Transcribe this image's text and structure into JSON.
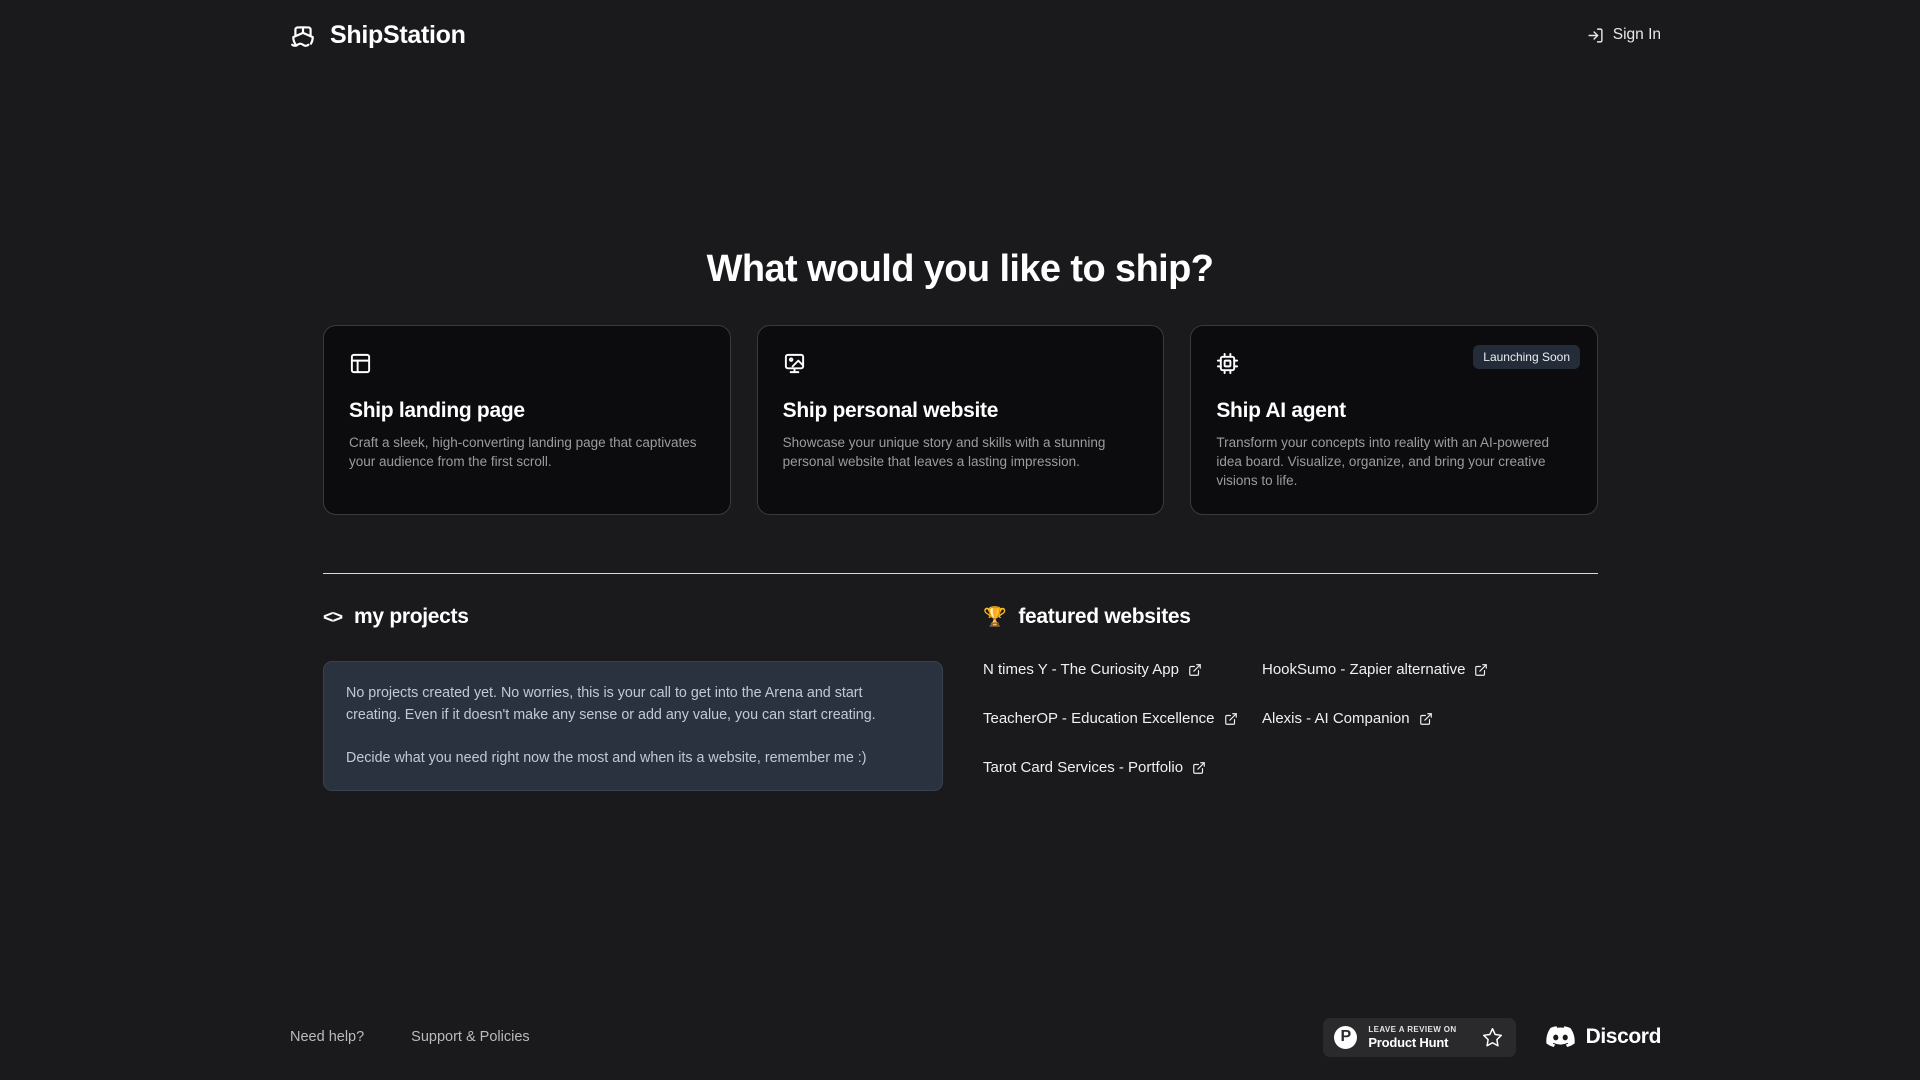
{
  "header": {
    "brand_name": "ShipStation",
    "brand_icon": "ship-icon",
    "signin_label": "Sign In",
    "signin_icon": "login-arrow-icon"
  },
  "hero": {
    "title": "What would you like to ship?"
  },
  "cards": [
    {
      "icon": "layout-panel-icon",
      "title": "Ship landing page",
      "description": "Craft a sleek, high-converting landing page that captivates your audience from the first scroll.",
      "badge": ""
    },
    {
      "icon": "image-icon",
      "title": "Ship personal website",
      "description": "Showcase your unique story and skills with a stunning personal website that leaves a lasting impression.",
      "badge": ""
    },
    {
      "icon": "cpu-chip-icon",
      "title": "Ship AI agent",
      "description": "Transform your concepts into reality with an AI-powered idea board. Visualize, organize, and bring your creative visions to life.",
      "badge": "Launching Soon"
    }
  ],
  "projects": {
    "icon": "code-brackets-icon",
    "icon_glyph": "<>",
    "heading": "my projects",
    "paragraph_1": "No projects created yet. No worries, this is your call to get into the Arena and start creating. Even if it doesn't make any sense or add any value, you can start creating.",
    "paragraph_2": "Decide what you need right now the most and when its a website, remember me :)"
  },
  "featured": {
    "icon": "trophy-icon",
    "icon_glyph": "🏆",
    "heading": "featured websites",
    "links": [
      {
        "label": "N times Y - The Curiosity App",
        "icon": "external-link-icon"
      },
      {
        "label": "HookSumo - Zapier alternative",
        "icon": "external-link-icon"
      },
      {
        "label": "TeacherOP - Education Excellence",
        "icon": "external-link-icon"
      },
      {
        "label": "Alexis - AI Companion",
        "icon": "external-link-icon"
      },
      {
        "label": "Tarot Card Services - Portfolio",
        "icon": "external-link-icon"
      }
    ]
  },
  "footer": {
    "links": [
      {
        "label": "Need help?"
      },
      {
        "label": "Support & Policies"
      }
    ],
    "product_hunt": {
      "logo_letter": "P",
      "top_text": "LEAVE A REVIEW ON",
      "bottom_text": "Product Hunt",
      "star_icon": "star-outline-icon"
    },
    "discord": {
      "icon": "discord-icon",
      "label": "Discord"
    }
  },
  "colors": {
    "page_background": "#1a1a1c",
    "card_background": "#0c0c0e",
    "card_border": "#3a3a3e",
    "projects_box": "#2a3240",
    "badge_background": "#242c3a",
    "accent_trophy": "#e8b931",
    "text_primary": "#ffffff",
    "text_muted": "#9b9ba1"
  }
}
